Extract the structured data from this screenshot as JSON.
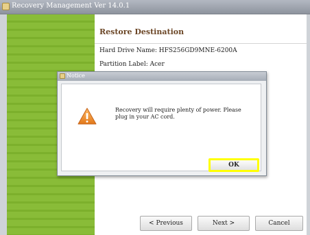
{
  "window": {
    "title": "Recovery Management Ver 14.0.1"
  },
  "page": {
    "heading": "Restore Destination",
    "hard_drive": "Hard Drive Name: HFS256GD9MNE-6200A",
    "partition": "Partition Label: Acer"
  },
  "nav": {
    "previous": "< Previous",
    "next": "Next >",
    "cancel": "Cancel"
  },
  "dialog": {
    "title": "Notice",
    "message": "Recovery will require plenty of power. Please plug in your AC cord.",
    "ok": "OK",
    "icon": "warning-icon",
    "highlight_color": "#ffff00"
  },
  "colors": {
    "sidebar": "#89bc38",
    "heading": "#6b4626"
  }
}
